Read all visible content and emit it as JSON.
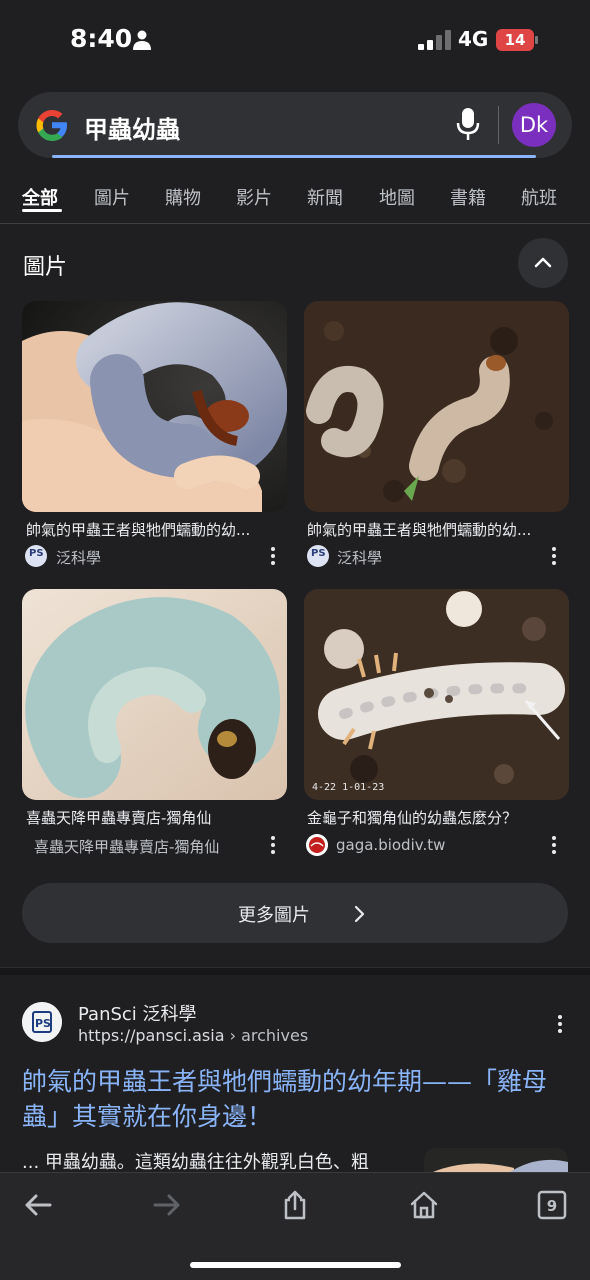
{
  "status_bar": {
    "time": "8:40",
    "network": "4G",
    "battery": "14"
  },
  "search": {
    "query": "甲蟲幼蟲",
    "avatar_initials": "Dk"
  },
  "tabs": [
    "全部",
    "圖片",
    "購物",
    "影片",
    "新聞",
    "地圖",
    "書籍",
    "航班"
  ],
  "images_section": {
    "title": "圖片",
    "cards": [
      {
        "title": "帥氣的甲蟲王者與牠們蠕動的幼...",
        "source": "泛科學"
      },
      {
        "title": "帥氣的甲蟲王者與牠們蠕動的幼...",
        "source": "泛科學"
      },
      {
        "title": "喜蟲天降甲蟲專賣店-獨角仙",
        "source": "喜蟲天降甲蟲專賣店-獨角仙"
      },
      {
        "title": "金龜子和獨角仙的幼蟲怎麼分？",
        "source": "gaga.biodiv.tw",
        "image_stamp": "4-22 1-01-23"
      }
    ],
    "more_label": "更多圖片"
  },
  "result": {
    "site_name": "PanSci 泛科學",
    "url_host": "https://pansci.asia",
    "url_path": " › archives",
    "title": "帥氣的甲蟲王者與牠們蠕動的幼年期——「雞母蟲」其實就在你身邊！",
    "snippet": "... 甲蟲幼蟲。這類幼蟲往往外觀乳白色、粗"
  },
  "toolbar": {
    "tab_count": "9"
  },
  "colors": {
    "background": "#1f1f21",
    "link": "#8ab4f8",
    "avatar": "#7b2fbf",
    "battery": "#e04545"
  }
}
